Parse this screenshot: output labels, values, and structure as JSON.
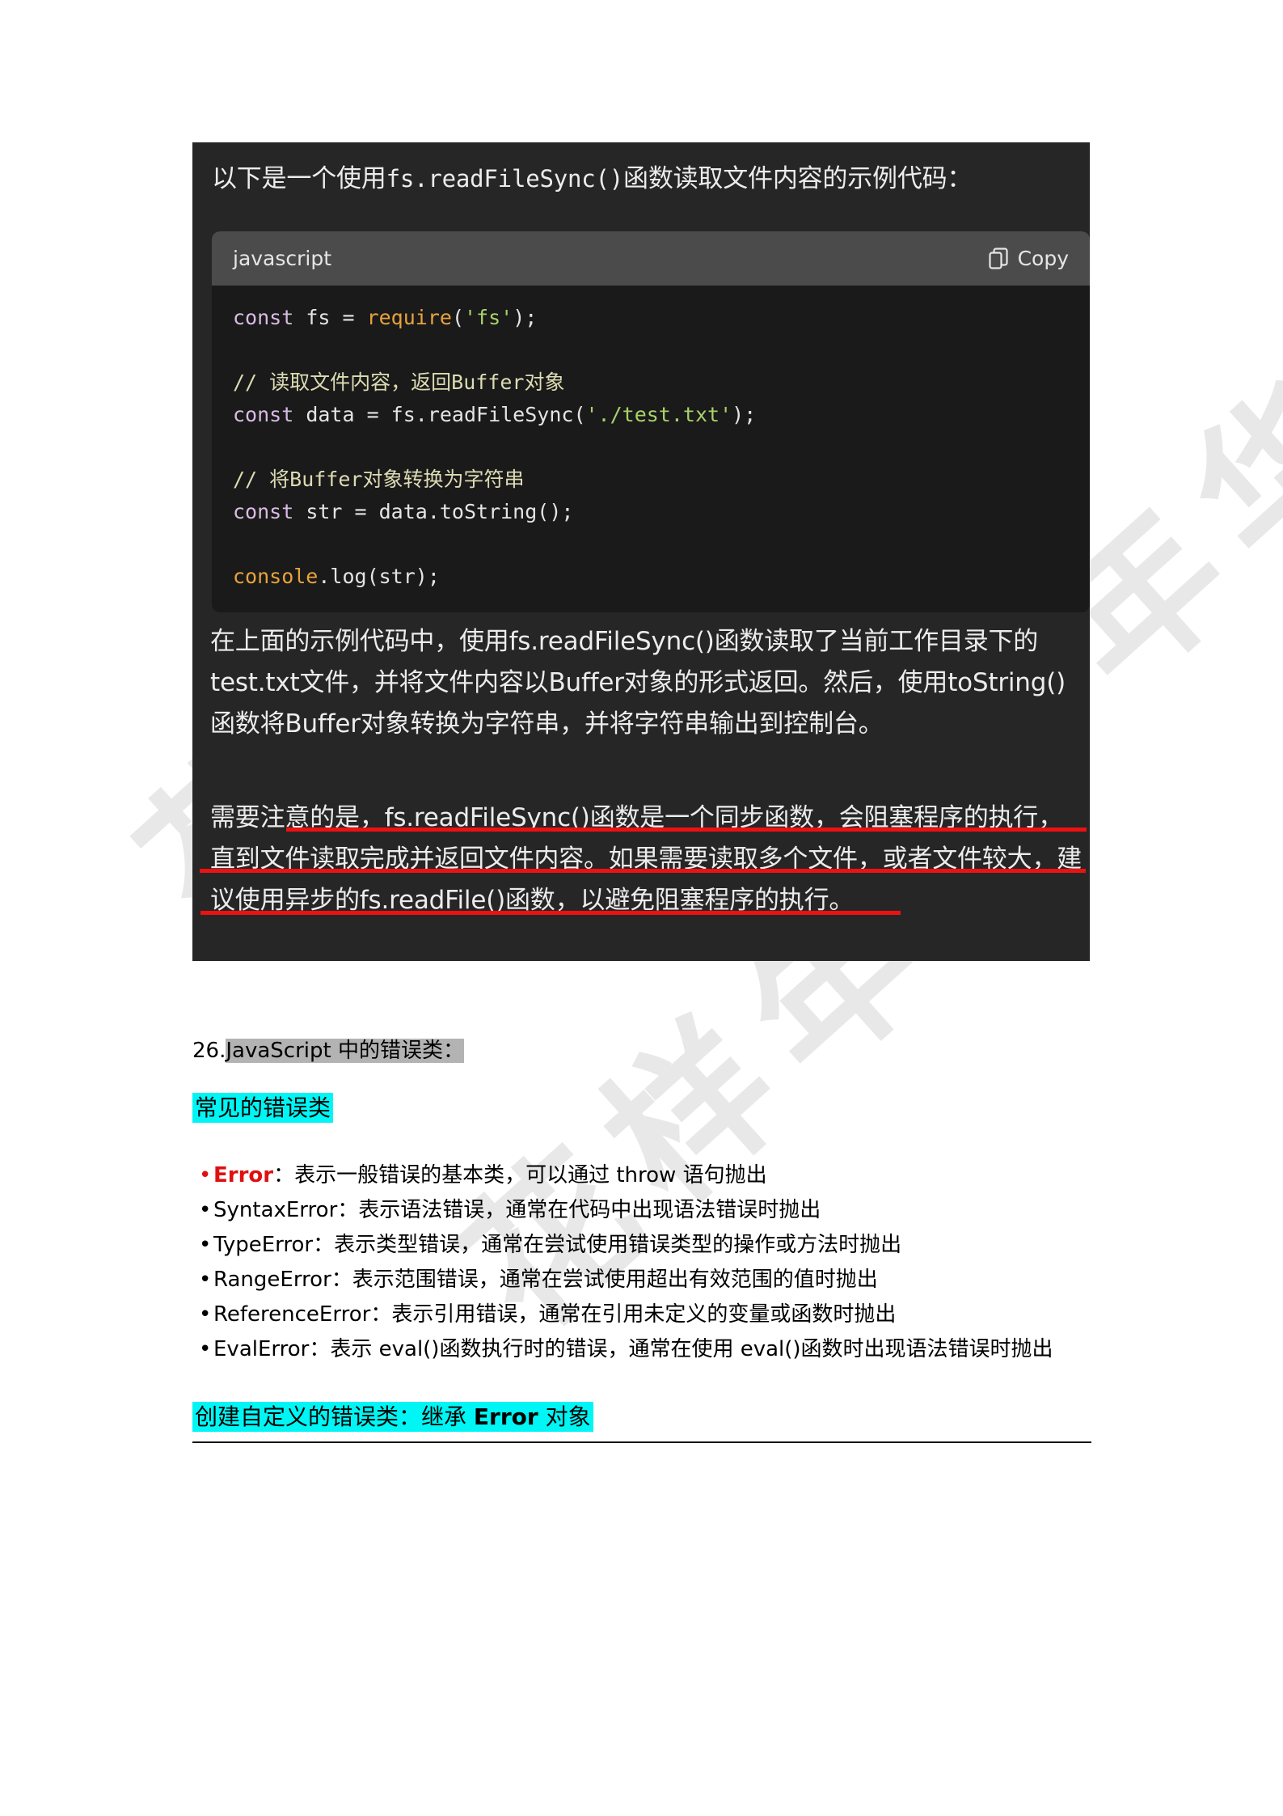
{
  "watermark": {
    "lines": [
      "花样年华",
      "花样年华",
      "花样年华"
    ],
    "color": "#e8e8e8"
  },
  "dark_block": {
    "background": "#262626",
    "intro_text": "以下是一个使用fs.readFileSync()函数读取文件内容的示例代码：",
    "intro_prefix": "以下是一个使用",
    "intro_mono": "fs.readFileSync()",
    "intro_suffix": "函数读取文件内容的示例代码：",
    "code_card": {
      "language_label": "javascript",
      "copy_label": "Copy",
      "copy_icon": "copy-pages-icon",
      "header_background": "#4b4b4b",
      "body_background": "#1a1a1a",
      "code_lines": [
        {
          "tokens": [
            {
              "t": "const ",
              "c": "kw"
            },
            {
              "t": "fs ",
              "c": "pl"
            },
            {
              "t": "= ",
              "c": "pl"
            },
            {
              "t": "require",
              "c": "fn"
            },
            {
              "t": "(",
              "c": "pl"
            },
            {
              "t": "'fs'",
              "c": "str"
            },
            {
              "t": ");",
              "c": "pl"
            }
          ]
        },
        {
          "tokens": []
        },
        {
          "tokens": [
            {
              "t": "// 读取文件内容，返回Buffer对象",
              "c": "cm"
            }
          ]
        },
        {
          "tokens": [
            {
              "t": "const ",
              "c": "kw"
            },
            {
              "t": "data = fs.readFileSync(",
              "c": "pl"
            },
            {
              "t": "'./test.txt'",
              "c": "str"
            },
            {
              "t": ");",
              "c": "pl"
            }
          ]
        },
        {
          "tokens": []
        },
        {
          "tokens": [
            {
              "t": "// 将Buffer对象转换为字符串",
              "c": "cm"
            }
          ]
        },
        {
          "tokens": [
            {
              "t": "const ",
              "c": "kw"
            },
            {
              "t": "str = data.toString();",
              "c": "pl"
            }
          ]
        },
        {
          "tokens": []
        },
        {
          "tokens": [
            {
              "t": "console",
              "c": "fn"
            },
            {
              "t": ".log(str);",
              "c": "pl"
            }
          ]
        }
      ]
    },
    "paragraph_1": "在上面的示例代码中，使用fs.readFileSync()函数读取了当前工作目录下的test.txt文件，并将文件内容以Buffer对象的形式返回。然后，使用toString()函数将Buffer对象转换为字符串，并将字符串输出到控制台。",
    "paragraph_2": "需要注意的是，fs.readFileSync()函数是一个同步函数，会阻塞程序的执行，直到文件读取完成并返回文件内容。如果需要读取多个文件，或者文件较大，建议使用异步的fs.readFile()函数，以避免阻塞程序的执行。",
    "annotation_color": "#ee1111"
  },
  "document": {
    "heading_number": "26.",
    "heading_highlighted": "JavaScript 中的错误类",
    "heading_trailing": "：",
    "heading_highlight_color": "#b3b3b3",
    "section_common_title": "常见的错误类",
    "section_common_highlight_color": "#00f5f5",
    "error_list": [
      {
        "name": "Error",
        "name_color": "#e01010",
        "bold": true,
        "desc": "：表示一般错误的基本类，可以通过 throw 语句抛出"
      },
      {
        "name": "SyntaxError",
        "name_color": "#000000",
        "bold": false,
        "desc": "：表示语法错误，通常在代码中出现语法错误时抛出"
      },
      {
        "name": "TypeError",
        "name_color": "#000000",
        "bold": false,
        "desc": "：表示类型错误，通常在尝试使用错误类型的操作或方法时抛出"
      },
      {
        "name": "RangeError",
        "name_color": "#000000",
        "bold": false,
        "desc": "：表示范围错误，通常在尝试使用超出有效范围的值时抛出"
      },
      {
        "name": "ReferenceError",
        "name_color": "#000000",
        "bold": false,
        "desc": "：表示引用错误，通常在引用未定义的变量或函数时抛出"
      },
      {
        "name": "EvalError",
        "name_color": "#000000",
        "bold": false,
        "desc": "：表示 eval()函数执行时的错误，通常在使用 eval()函数时出现语法错误时抛出"
      }
    ],
    "section_custom_title_a": "创建自定义的错误类：继承 ",
    "section_custom_title_bold": "Error",
    "section_custom_title_b": " 对象",
    "section_custom_highlight_color": "#00f5f5"
  }
}
